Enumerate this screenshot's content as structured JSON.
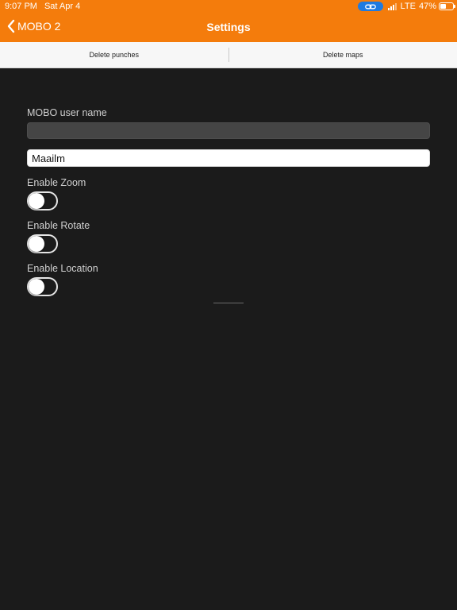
{
  "status_bar": {
    "time": "9:07 PM",
    "date": "Sat Apr 4",
    "network": "LTE",
    "battery_percent": "47%",
    "battery_level": 0.47,
    "link_icon": "link-icon",
    "accent_color": "#1f7ae0"
  },
  "nav": {
    "back_label": "MOBO 2",
    "title": "Settings",
    "back_icon": "chevron-left-icon",
    "bar_color": "#f47c0c"
  },
  "toolbar": {
    "delete_punches": "Delete punches",
    "delete_maps": "Delete maps"
  },
  "form": {
    "user_name_label": "MOBO user name",
    "user_name_value": "",
    "text_field_value": "Maailm",
    "zoom_label": "Enable Zoom",
    "zoom_enabled": false,
    "rotate_label": "Enable Rotate",
    "rotate_enabled": false,
    "location_label": "Enable Location",
    "location_enabled": false
  }
}
